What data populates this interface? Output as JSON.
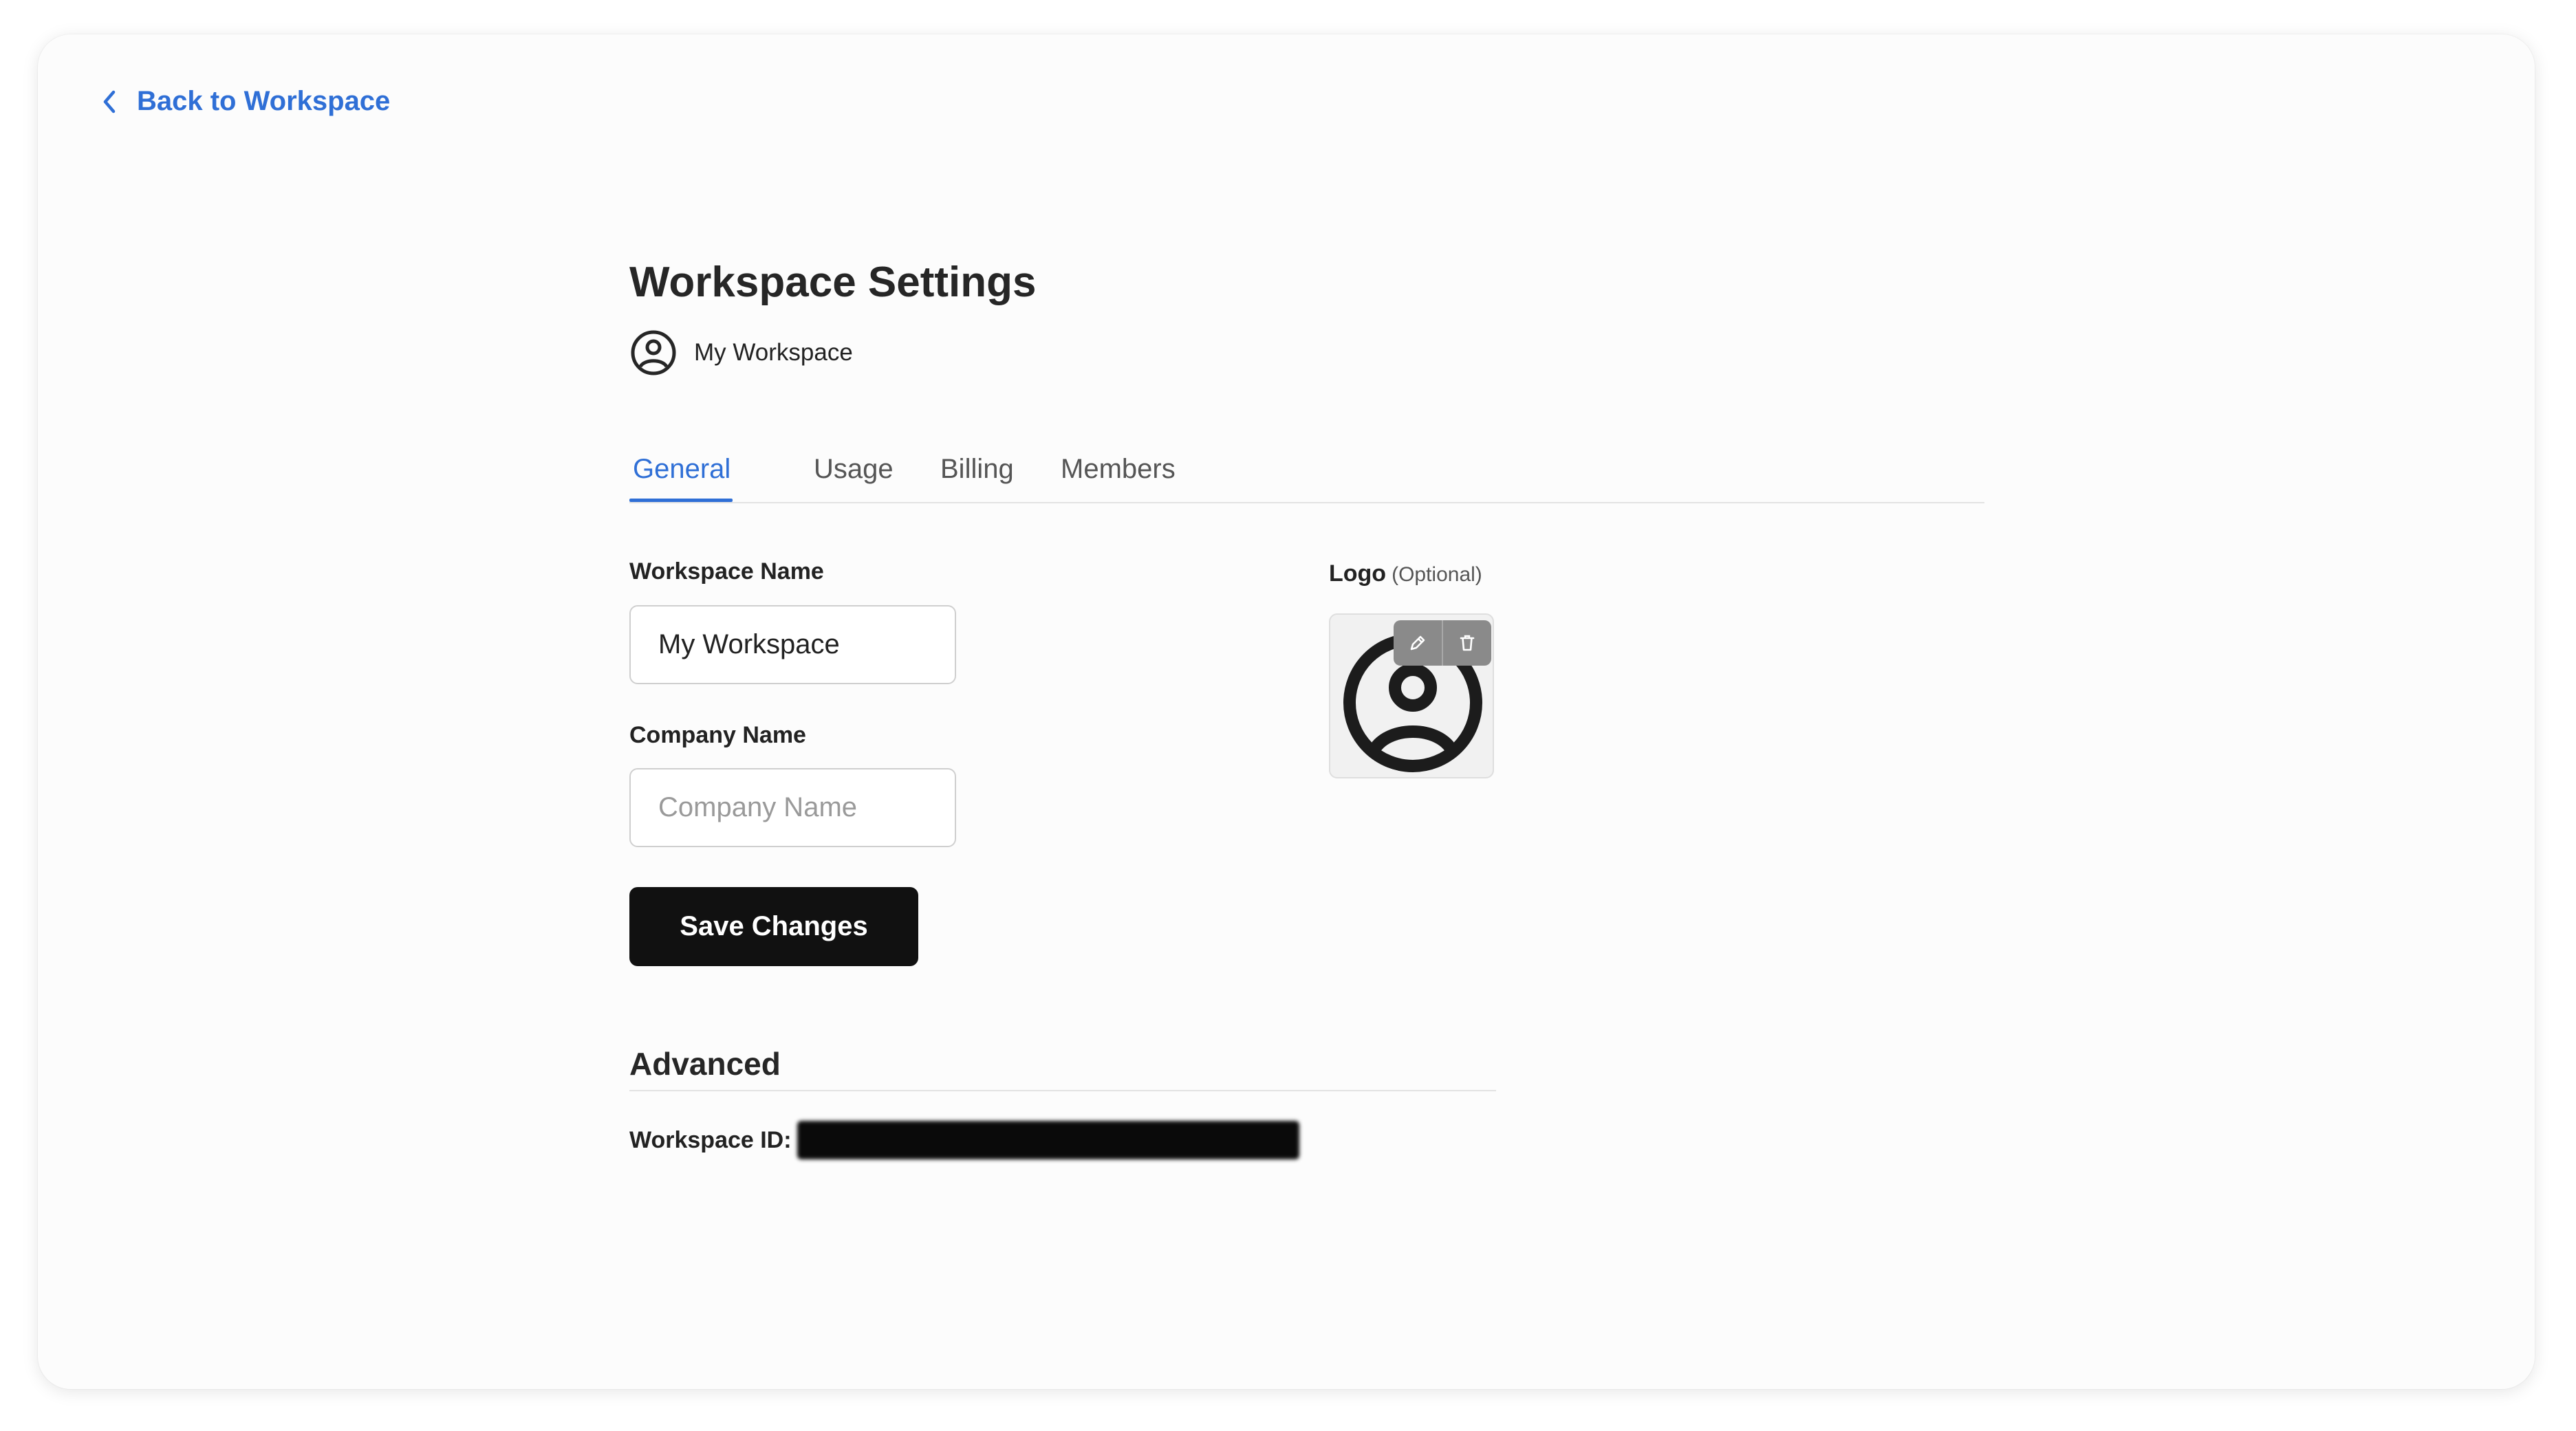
{
  "nav": {
    "back_label": "Back to Workspace"
  },
  "page": {
    "title": "Workspace Settings",
    "workspace_name": "My Workspace"
  },
  "tabs": [
    {
      "label": "General",
      "active": true
    },
    {
      "label": "Usage",
      "active": false
    },
    {
      "label": "Billing",
      "active": false
    },
    {
      "label": "Members",
      "active": false
    }
  ],
  "form": {
    "workspace_name_label": "Workspace Name",
    "workspace_name_value": "My Workspace",
    "company_name_label": "Company Name",
    "company_name_value": "",
    "company_name_placeholder": "Company Name",
    "save_label": "Save Changes"
  },
  "logo": {
    "label": "Logo",
    "optional_label": "(Optional)",
    "icon": "user-circle-icon"
  },
  "advanced": {
    "title": "Advanced",
    "workspace_id_label": "Workspace ID:"
  },
  "colors": {
    "accent": "#2f6fd6",
    "button": "#111111",
    "text": "#262626"
  }
}
